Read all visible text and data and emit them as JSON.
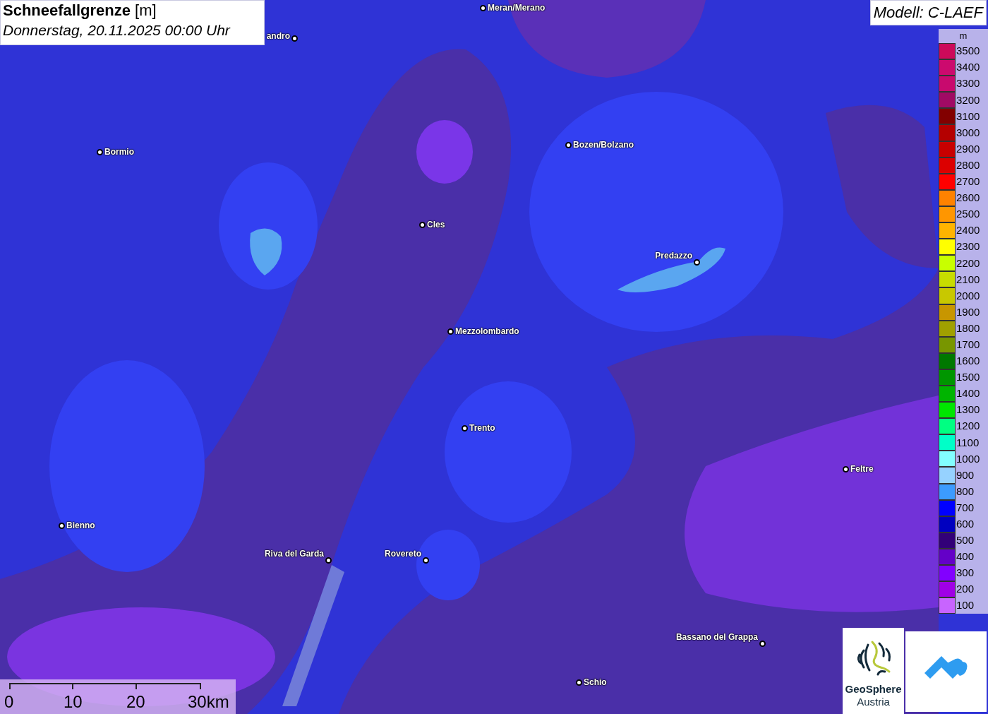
{
  "header": {
    "title": "Schneefallgrenze",
    "unit": "[m]",
    "subtitle": "Donnerstag, 20.11.2025 00:00 Uhr"
  },
  "model_label": "Modell: C-LAEF",
  "cities": [
    {
      "name": "Meran/Merano"
    },
    {
      "name": "andro"
    },
    {
      "name": "Bormio"
    },
    {
      "name": "Bozen/Bolzano"
    },
    {
      "name": "Cles"
    },
    {
      "name": "Predazzo"
    },
    {
      "name": "Mezzolombardo"
    },
    {
      "name": "Trento"
    },
    {
      "name": "Feltre"
    },
    {
      "name": "Bienno"
    },
    {
      "name": "Riva del Garda"
    },
    {
      "name": "Rovereto"
    },
    {
      "name": "Bassano del Grappa"
    },
    {
      "name": "Schio"
    }
  ],
  "legend": {
    "unit": "m",
    "items": [
      {
        "label": "3500",
        "color": "#cc0a5a"
      },
      {
        "label": "3400",
        "color": "#cc0a6e"
      },
      {
        "label": "3300",
        "color": "#c80a6e"
      },
      {
        "label": "3200",
        "color": "#a00a64"
      },
      {
        "label": "3100",
        "color": "#820000"
      },
      {
        "label": "3000",
        "color": "#b40000"
      },
      {
        "label": "2900",
        "color": "#c80000"
      },
      {
        "label": "2800",
        "color": "#dc0000"
      },
      {
        "label": "2700",
        "color": "#ff0000"
      },
      {
        "label": "2600",
        "color": "#ff8200"
      },
      {
        "label": "2500",
        "color": "#ff9600"
      },
      {
        "label": "2400",
        "color": "#ffb400"
      },
      {
        "label": "2300",
        "color": "#ffff00"
      },
      {
        "label": "2200",
        "color": "#c8ff00"
      },
      {
        "label": "2100",
        "color": "#c8dc00"
      },
      {
        "label": "2000",
        "color": "#c8c800"
      },
      {
        "label": "1900",
        "color": "#c89600"
      },
      {
        "label": "1800",
        "color": "#a0a000"
      },
      {
        "label": "1700",
        "color": "#789600"
      },
      {
        "label": "1600",
        "color": "#007800"
      },
      {
        "label": "1500",
        "color": "#009600"
      },
      {
        "label": "1400",
        "color": "#00b400"
      },
      {
        "label": "1300",
        "color": "#00e600"
      },
      {
        "label": "1200",
        "color": "#00ff82"
      },
      {
        "label": "1100",
        "color": "#00ffc8"
      },
      {
        "label": "1000",
        "color": "#82ffff"
      },
      {
        "label": "900",
        "color": "#96d2ff"
      },
      {
        "label": "800",
        "color": "#3c9bff"
      },
      {
        "label": "700",
        "color": "#0000ff"
      },
      {
        "label": "600",
        "color": "#0000c0"
      },
      {
        "label": "500",
        "color": "#320078"
      },
      {
        "label": "400",
        "color": "#6400c8"
      },
      {
        "label": "300",
        "color": "#8200ff"
      },
      {
        "label": "200",
        "color": "#a000e6"
      },
      {
        "label": "100",
        "color": "#c864ff"
      }
    ]
  },
  "scale_bar": {
    "ticks": [
      "0",
      "10",
      "20",
      "30km"
    ]
  },
  "logos": {
    "geosphere_name": "GeoSphere",
    "geosphere_country": "Austria"
  }
}
